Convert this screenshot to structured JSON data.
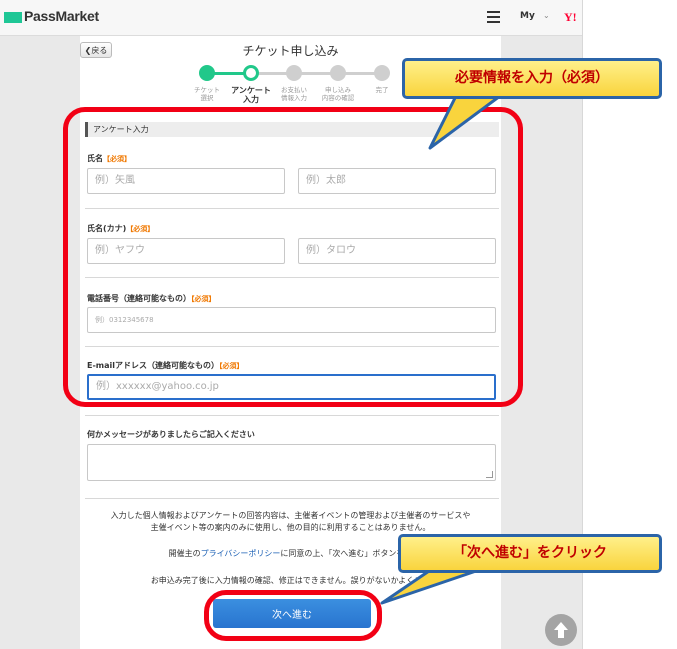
{
  "header": {
    "logo_text": "PassMarket",
    "my_label": "My",
    "my_caret": "⌄",
    "yahoo_label": "Y!",
    "icons": [
      "menu-icon",
      "yahoo-icon"
    ]
  },
  "page": {
    "back_label": "❮戻る",
    "title": "チケット申し込み"
  },
  "steps": [
    {
      "line1": "チケット",
      "line2": "選択",
      "state": "done"
    },
    {
      "line1": "アンケート",
      "line2": "入力",
      "state": "current"
    },
    {
      "line1": "お支払い",
      "line2": "情報入力",
      "state": "todo"
    },
    {
      "line1": "申し込み",
      "line2": "内容の確認",
      "state": "todo"
    },
    {
      "line1": "完了",
      "line2": "",
      "state": "todo"
    }
  ],
  "form": {
    "section_title": "アンケート入力",
    "required_tag": "【必須】",
    "name_label": "氏名",
    "name_last_placeholder": "例）矢風",
    "name_first_placeholder": "例）太郎",
    "kana_label": "氏名(カナ)",
    "kana_last_placeholder": "例）ヤフウ",
    "kana_first_placeholder": "例）タロウ",
    "phone_label": "電話番号（連絡可能なもの）",
    "phone_placeholder": "例）0312345678",
    "email_label": "E-mailアドレス（連絡可能なもの）",
    "email_placeholder": "例）xxxxxx@yahoo.co.jp",
    "message_label": "何かメッセージがありましたらご記入ください",
    "notice1": "入力した個人情報およびアンケートの回答内容は、主催者イベントの管理および主催者のサービスや",
    "notice2": "主催イベント等の案内のみに使用し、他の目的に利用することはありません。",
    "agree_prefix": "開催主の",
    "agree_link": "プライバシーポリシー",
    "agree_suffix": "に同意の上、「次へ進む」ボタンを押",
    "final_notice": "お申込み完了後に入力情報の確認、修正はできません。誤りがないかよくご確",
    "next_label": "次へ進む"
  },
  "annotations": {
    "callout_top": "必要情報を入力（必須）",
    "callout_bottom": "「次へ進む」をクリック",
    "highlight_color": "#f20015",
    "callout_border_color": "#2b64a8",
    "callout_fill_color": "#fbe152"
  },
  "colors": {
    "brand_green": "#1fc796",
    "step_green": "#21c88a",
    "button_blue": "#2874cf",
    "required_orange": "#f07800"
  }
}
